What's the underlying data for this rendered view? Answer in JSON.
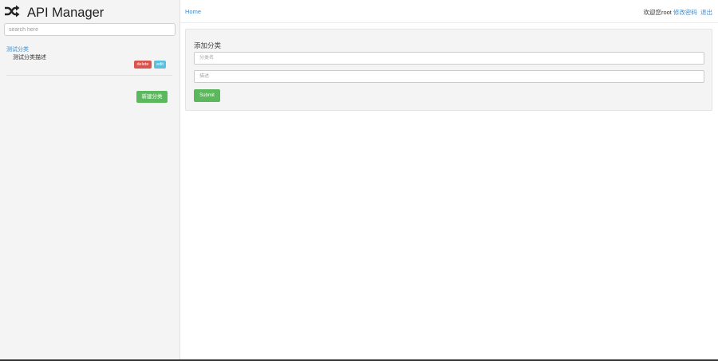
{
  "brand": {
    "title": "API Manager",
    "icon": "shuffle-icon"
  },
  "sidebar": {
    "search_placeholder": "search here",
    "categories": [
      {
        "title": "测试分类",
        "description": "测试分类描述",
        "delete_label": "delete",
        "edit_label": "edit"
      }
    ],
    "new_category_label": "新建分类"
  },
  "topbar": {
    "home_label": "Home",
    "welcome_text": "欢迎您root",
    "change_password_label": "修改密码",
    "logout_label": "退出"
  },
  "form": {
    "title": "添加分类",
    "name_placeholder": "分类名",
    "desc_placeholder": "描述",
    "submit_label": "Submit"
  },
  "colors": {
    "link": "#428bca",
    "success": "#5cb85c",
    "danger": "#d9534f",
    "info": "#5bc0de",
    "sidebar_bg": "#f4f4f4"
  }
}
